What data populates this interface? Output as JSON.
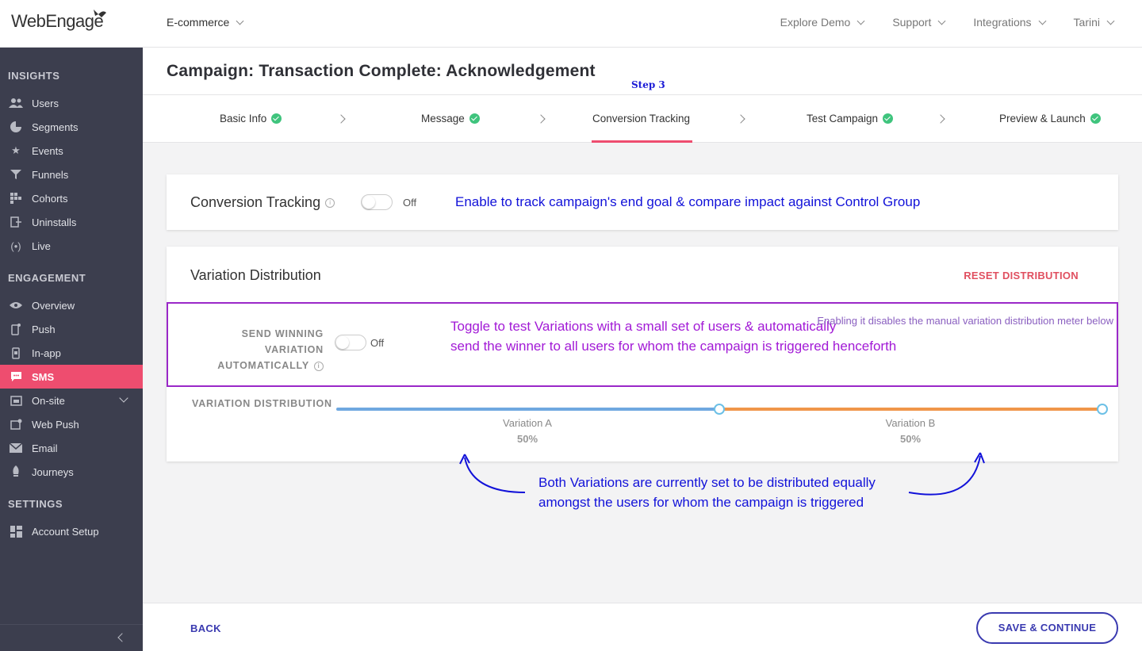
{
  "brand": {
    "logo_text": "WebEngage"
  },
  "header": {
    "project": "E-commerce",
    "nav": [
      "Explore Demo",
      "Support",
      "Integrations",
      "Tarini"
    ]
  },
  "sidebar": {
    "sections": [
      {
        "title": "INSIGHTS",
        "items": [
          "Users",
          "Segments",
          "Events",
          "Funnels",
          "Cohorts",
          "Uninstalls",
          "Live"
        ]
      },
      {
        "title": "ENGAGEMENT",
        "items": [
          "Overview",
          "Push",
          "In-app",
          "SMS",
          "On-site",
          "Web Push",
          "Email",
          "Journeys"
        ]
      },
      {
        "title": "SETTINGS",
        "items": [
          "Account Setup"
        ]
      }
    ],
    "active": "SMS"
  },
  "page": {
    "title": "Campaign: Transaction Complete: Acknowledgement",
    "step_note": "Step 3"
  },
  "steps": [
    "Basic Info",
    "Message",
    "Conversion Tracking",
    "Test Campaign",
    "Preview & Launch"
  ],
  "conversion": {
    "title": "Conversion Tracking",
    "toggle_state": "Off",
    "annotation": "Enable to track campaign's end goal & compare impact against Control Group"
  },
  "variation": {
    "title": "Variation Distribution",
    "reset_label": "RESET DISTRIBUTION",
    "send_winning_label": [
      "SEND WINNING",
      "VARIATION",
      "AUTOMATICALLY"
    ],
    "send_winning_state": "Off",
    "annotation_line1": "Toggle to test Variations with a small set of users & automatically",
    "annotation_line2": "send the winner to all users for whom the campaign is triggered henceforth",
    "disable_note": "Enabling it disables the manual variation distribution meter below",
    "distribution_label": "VARIATION DISTRIBUTION",
    "variants": [
      {
        "name": "Variation A",
        "percent": "50%",
        "share": 0.5
      },
      {
        "name": "Variation B",
        "percent": "50%",
        "share": 0.5
      }
    ],
    "bottom_note_line1": "Both Variations are currently set to be distributed equally",
    "bottom_note_line2": "amongst the users for whom the campaign is triggered"
  },
  "footer": {
    "back": "BACK",
    "save": "SAVE & CONTINUE"
  },
  "colors": {
    "accent": "#ee4d6f",
    "sidebar": "#3c3e4e",
    "primary_button": "#3a3ab0",
    "annotation_blue": "#1212d9",
    "annotation_purple": "#a21ad6"
  }
}
